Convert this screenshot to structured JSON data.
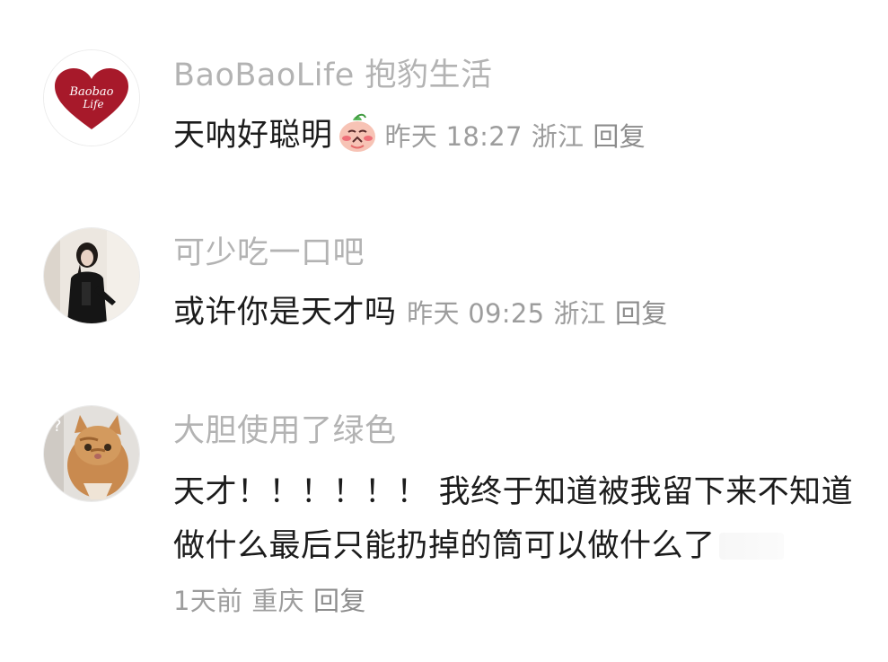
{
  "comments": [
    {
      "username": "BaoBaoLife 抱豹生活",
      "text": "天呐好聪明",
      "emoji": "blushing-peach-emoji",
      "time": "昨天 18:27",
      "location": "浙江",
      "reply": "回复",
      "avatar_logo_text": [
        "Baobao",
        "Life"
      ],
      "avatar_color": "#a7192a"
    },
    {
      "username": "可少吃一口吧",
      "text": "或许你是天才吗",
      "time": "昨天 09:25",
      "location": "浙江",
      "reply": "回复"
    },
    {
      "username": "大胆使用了绿色",
      "text": "天才！！！！！！ 我终于知道被我留下来不知道做什么最后只能扔掉的筒可以做什么了",
      "time": "1天前",
      "location": "重庆",
      "reply": "回复"
    }
  ],
  "colors": {
    "username": "#b3b3b3",
    "text": "#1c1c1c",
    "meta": "#9d9d9d"
  }
}
